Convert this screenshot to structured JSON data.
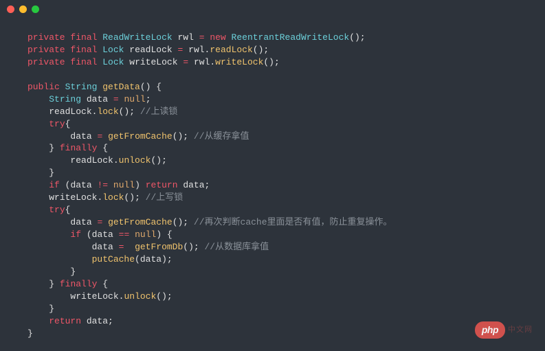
{
  "titlebar": {
    "close": "close",
    "minimize": "minimize",
    "zoom": "zoom"
  },
  "code": {
    "l1_kw1": "private",
    "l1_kw2": "final",
    "l1_type": "ReadWriteLock",
    "l1_id": "rwl",
    "l1_op": "=",
    "l1_kw3": "new",
    "l1_ctor": "ReentrantReadWriteLock",
    "l1_p": "();",
    "l2_kw1": "private",
    "l2_kw2": "final",
    "l2_type": "Lock",
    "l2_id": "readLock",
    "l2_op": "=",
    "l2_obj": "rwl",
    "l2_dot": ".",
    "l2_m": "readLock",
    "l2_p": "();",
    "l3_kw1": "private",
    "l3_kw2": "final",
    "l3_type": "Lock",
    "l3_id": "writeLock",
    "l3_op": "=",
    "l3_obj": "rwl",
    "l3_dot": ".",
    "l3_m": "writeLock",
    "l3_p": "();",
    "l5_kw": "public",
    "l5_type": "String",
    "l5_m": "getData",
    "l5_p": "() {",
    "l6_type": "String",
    "l6_id": "data",
    "l6_op": "=",
    "l6_null": "null",
    "l6_sc": ";",
    "l7_obj": "readLock",
    "l7_dot": ".",
    "l7_m": "lock",
    "l7_p": "();",
    "l7_cmt": " //上读锁",
    "l8_kw": "try",
    "l8_p": "{",
    "l9_id": "data",
    "l9_op": "=",
    "l9_m": "getFromCache",
    "l9_p": "();",
    "l9_cmt": " //从缓存拿值",
    "l10_p": "}",
    "l10_kw": "finally",
    "l10_p2": " {",
    "l11_obj": "readLock",
    "l11_dot": ".",
    "l11_m": "unlock",
    "l11_p": "();",
    "l12_p": "}",
    "l13_kw1": "if",
    "l13_p1": " (",
    "l13_id": "data",
    "l13_op": "!=",
    "l13_null": "null",
    "l13_p2": ") ",
    "l13_kw2": "return",
    "l13_id2": " data",
    "l13_sc": ";",
    "l14_obj": "writeLock",
    "l14_dot": ".",
    "l14_m": "lock",
    "l14_p": "();",
    "l14_cmt": " //上写锁",
    "l15_kw": "try",
    "l15_p": "{",
    "l16_id": "data",
    "l16_op": "=",
    "l16_m": "getFromCache",
    "l16_p": "();",
    "l16_cmt": " //再次判断cache里面是否有值，防止重复操作。",
    "l17_kw": "if",
    "l17_p1": " (",
    "l17_id": "data",
    "l17_op": "==",
    "l17_null": "null",
    "l17_p2": ") {",
    "l18_id": "data",
    "l18_op": "=",
    "l18_m": "getFromDb",
    "l18_p": "();",
    "l18_cmt": " //从数据库拿值",
    "l19_m": "putCache",
    "l19_p1": "(",
    "l19_id": "data",
    "l19_p2": ");",
    "l20_p": "}",
    "l21_p": "}",
    "l21_kw": "finally",
    "l21_p2": " {",
    "l22_obj": "writeLock",
    "l22_dot": ".",
    "l22_m": "unlock",
    "l22_p": "();",
    "l23_p": "}",
    "l24_kw": "return",
    "l24_id": " data",
    "l24_sc": ";",
    "l25_p": "}"
  },
  "watermark": {
    "badge": "php",
    "text": "中文网"
  }
}
